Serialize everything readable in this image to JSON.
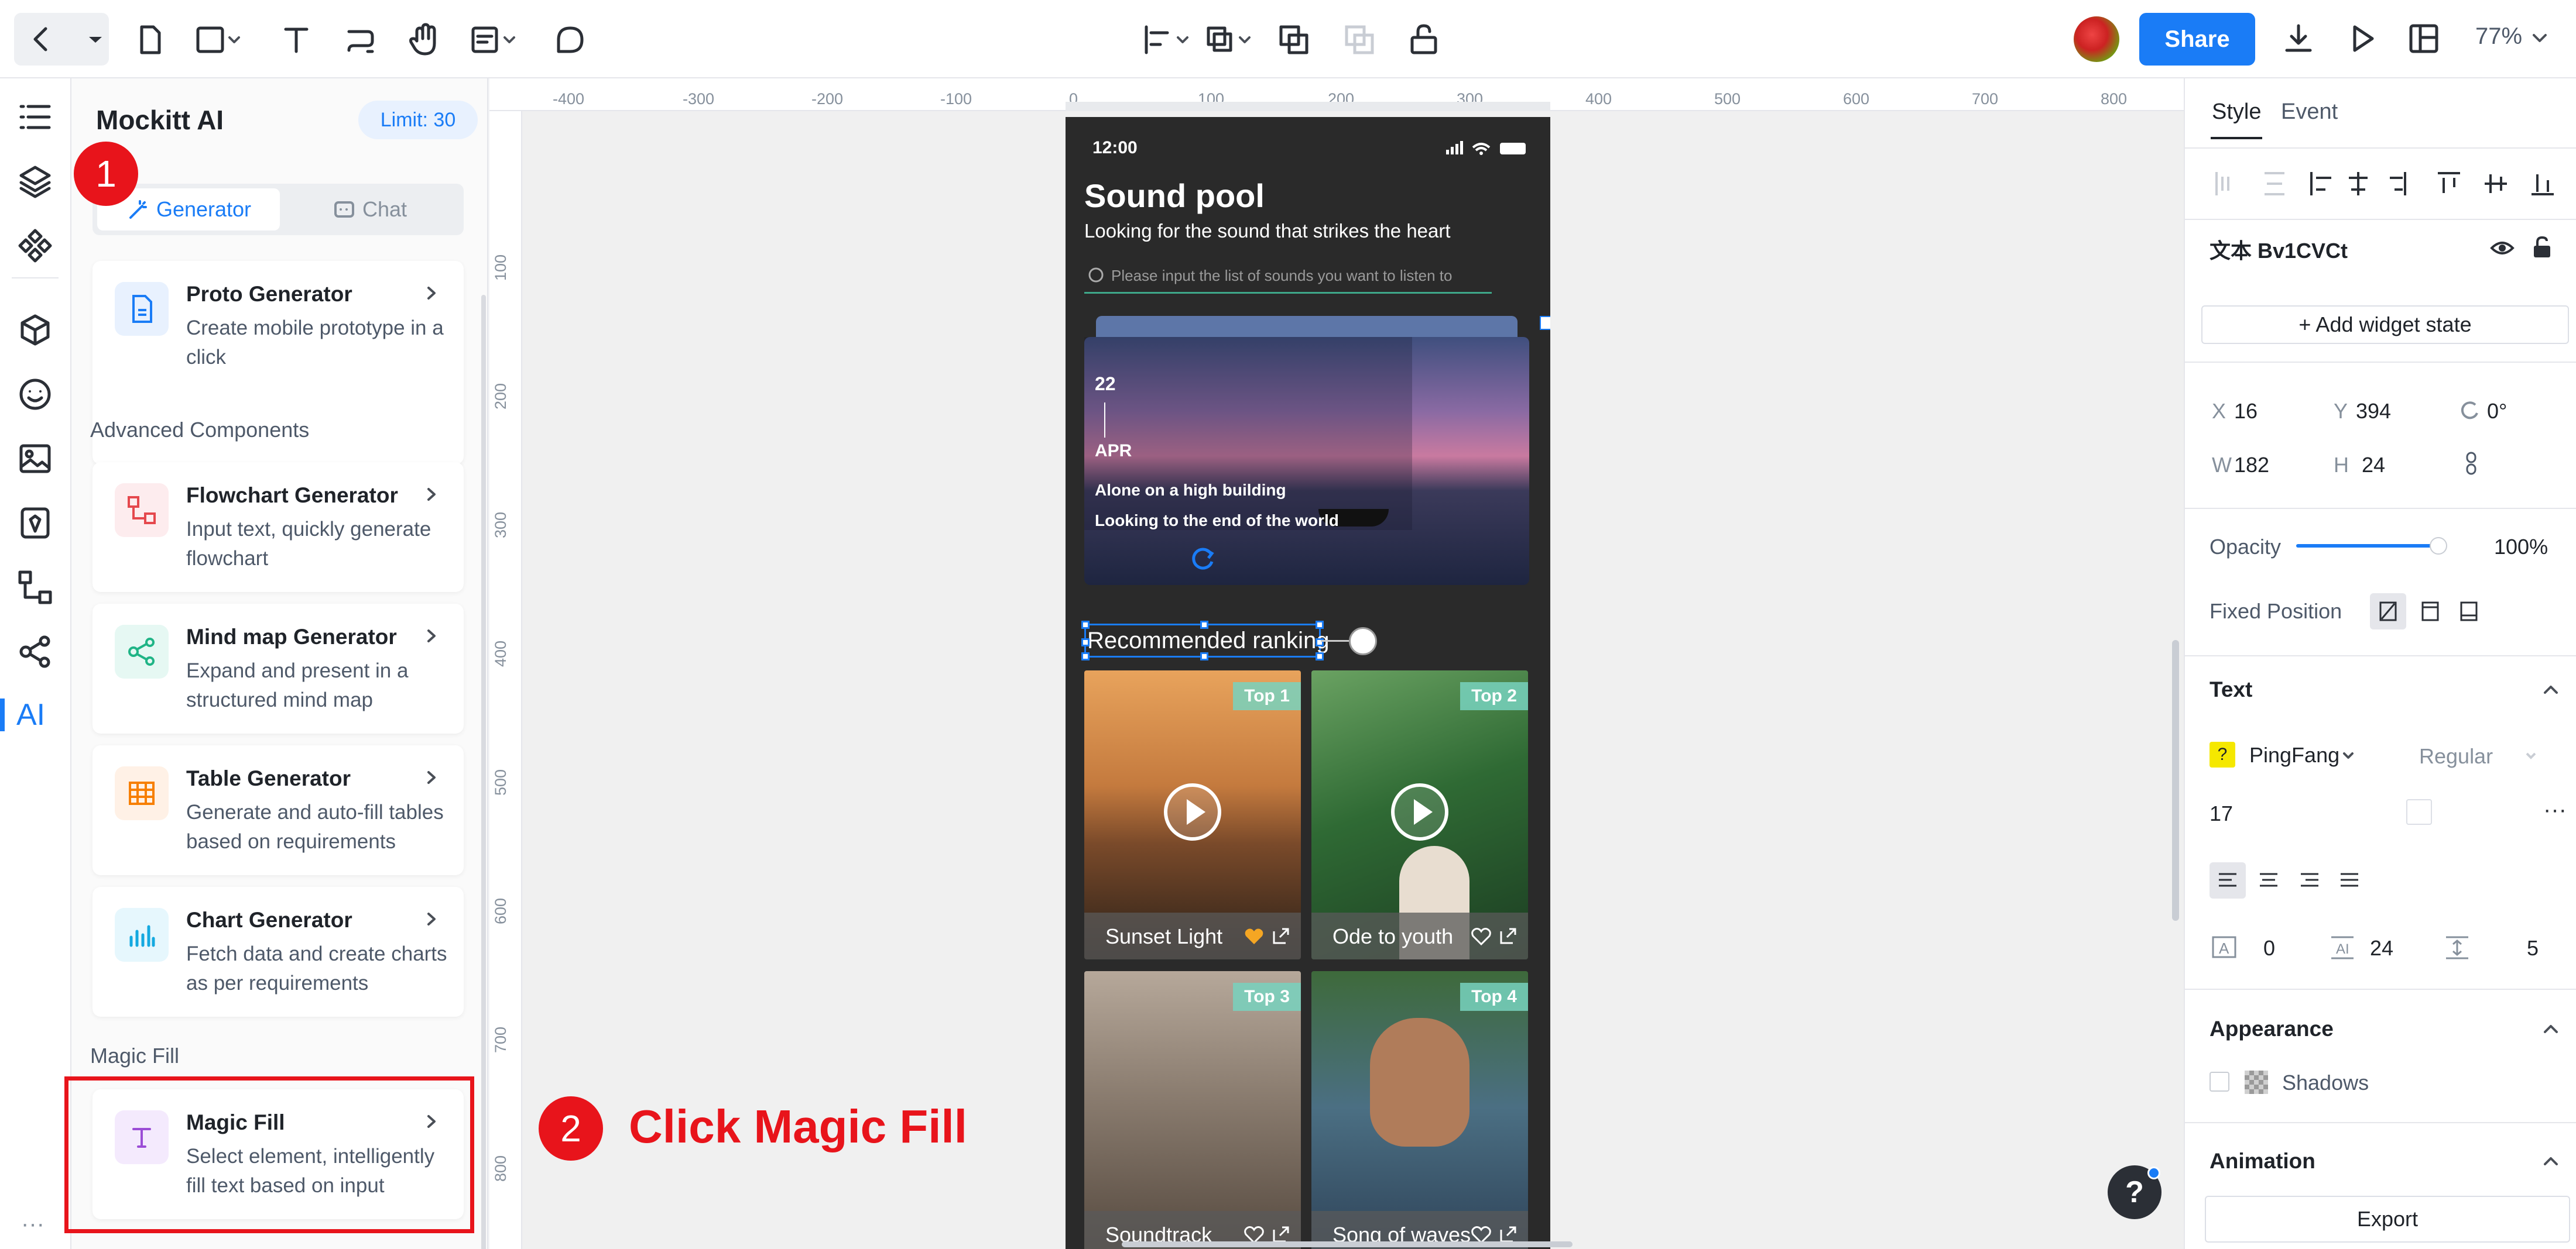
{
  "topbar": {
    "share_label": "Share",
    "zoom": "77%"
  },
  "ai_panel": {
    "title": "Mockitt AI",
    "limit": "Limit: 30",
    "tabs": [
      {
        "label": "Generator"
      },
      {
        "label": "Chat"
      }
    ],
    "cards": [
      {
        "title": "Proto Generator",
        "desc": "Create mobile prototype in a click",
        "icon": "doc-icon"
      },
      {
        "title": "Flowchart Generator",
        "desc": "Input text, quickly generate flowchart",
        "icon": "flowchart-icon"
      },
      {
        "title": "Mind map Generator",
        "desc": "Expand and present in a structured mind map",
        "icon": "mindmap-icon"
      },
      {
        "title": "Table Generator",
        "desc": "Generate and auto-fill tables based on requirements",
        "icon": "table-icon"
      },
      {
        "title": "Chart Generator",
        "desc": "Fetch data and create charts as per requirements",
        "icon": "chart-icon"
      },
      {
        "title": "Magic Fill",
        "desc": "Select element, intelligently fill text based on input",
        "icon": "text-icon"
      }
    ],
    "sections": {
      "advanced": "Advanced Components",
      "magic": "Magic Fill"
    }
  },
  "annotations": {
    "step1": "1",
    "step2": "2",
    "step2_text": "Click Magic Fill"
  },
  "ruler": {
    "top": [
      "-400",
      "-300",
      "-200",
      "-100",
      "0",
      "100",
      "200",
      "300",
      "400",
      "500",
      "600",
      "700",
      "800"
    ],
    "left": [
      "100",
      "200",
      "300",
      "400",
      "500",
      "600",
      "700",
      "800"
    ]
  },
  "phone": {
    "time": "12:00",
    "title": "Sound pool",
    "subtitle": "Looking for the sound that strikes the heart",
    "search_placeholder": "Please input the list of sounds you want to listen to",
    "banner": {
      "day": "22",
      "month": "APR",
      "line1": "Alone on a high building",
      "line2": "Looking to the end of the world"
    },
    "section_title": "Recommended ranking",
    "tiles": [
      {
        "badge": "Top 1",
        "name": "Sunset Light"
      },
      {
        "badge": "Top 2",
        "name": "Ode to youth"
      },
      {
        "badge": "Top 3",
        "name": "Soundtrack"
      },
      {
        "badge": "Top 4",
        "name": "Song of waves"
      }
    ]
  },
  "right_panel": {
    "tabs": [
      {
        "label": "Style"
      },
      {
        "label": "Event"
      }
    ],
    "element_name": "文本 Bv1CVCt",
    "add_state": "+ Add widget state",
    "x_label": "X",
    "x": "16",
    "y_label": "Y",
    "y": "394",
    "rot": "0°",
    "w_label": "W",
    "w": "182",
    "h_label": "H",
    "h": "24",
    "opacity_label": "Opacity",
    "opacity": "100%",
    "fixed_label": "Fixed Position",
    "text_section": "Text",
    "font": "PingFang",
    "weight": "Regular",
    "size": "17",
    "spacing": {
      "letter": "0",
      "line": "24",
      "para": "5"
    },
    "appearance_section": "Appearance",
    "shadows": "Shadows",
    "animation_section": "Animation",
    "export": "Export"
  },
  "colors": {
    "accent": "#1a7cf6",
    "annotation_red": "#e8141b"
  }
}
